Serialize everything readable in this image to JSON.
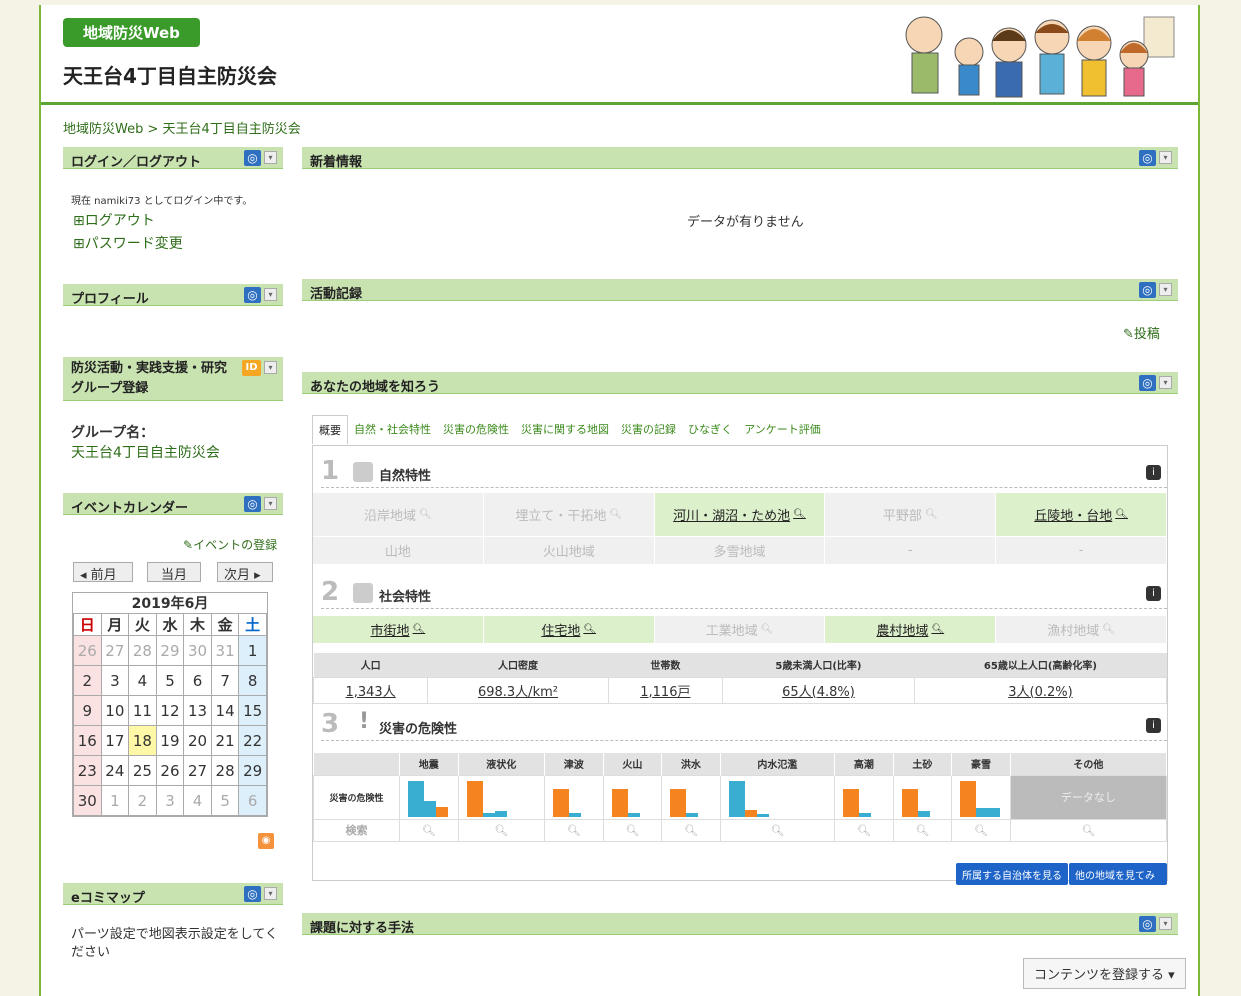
{
  "header": {
    "badge": "地域防災Web",
    "title": "天王台4丁目自主防災会"
  },
  "breadcrumb": {
    "root": "地域防災Web",
    "sep": " > ",
    "current": "天王台4丁目自主防災会"
  },
  "left": {
    "login": {
      "title": "ログイン／ログアウト",
      "status": "現在 namiki73 としてログイン中です。",
      "logout": "ログアウト",
      "password": "パスワード変更"
    },
    "profile": {
      "title": "プロフィール"
    },
    "group": {
      "title_line1": "防災活動・実践支援・研究",
      "title_line2": "グループ登録",
      "id_badge": "ID",
      "name_label": "グループ名：",
      "name_value": "天王台4丁目自主防災会"
    },
    "calendar": {
      "title": "イベントカレンダー",
      "add_event": "イベントの登録",
      "prev": "◂ 前月",
      "today": "当月",
      "next": "次月 ▸",
      "month": "2019年6月",
      "weekdays": [
        "日",
        "月",
        "火",
        "水",
        "木",
        "金",
        "土"
      ],
      "rows": [
        [
          "26",
          "27",
          "28",
          "29",
          "30",
          "31",
          "1"
        ],
        [
          "2",
          "3",
          "4",
          "5",
          "6",
          "7",
          "8"
        ],
        [
          "9",
          "10",
          "11",
          "12",
          "13",
          "14",
          "15"
        ],
        [
          "16",
          "17",
          "18",
          "19",
          "20",
          "21",
          "22"
        ],
        [
          "23",
          "24",
          "25",
          "26",
          "27",
          "28",
          "29"
        ],
        [
          "30",
          "1",
          "2",
          "3",
          "4",
          "5",
          "6"
        ]
      ]
    },
    "ecomap": {
      "title": "eコミマップ",
      "note": "パーツ設定で地図表示設定をしてください"
    }
  },
  "main": {
    "news": {
      "title": "新着情報",
      "empty": "データが有りません"
    },
    "activity": {
      "title": "活動記録",
      "post": "投稿"
    },
    "know": {
      "title": "あなたの地域を知ろう",
      "tabs": [
        "概要",
        "自然・社会特性",
        "災害の危険性",
        "災害に関する地図",
        "災害の記録",
        "ひなぎく",
        "アンケート評価"
      ],
      "s1": {
        "num": "1",
        "label": "自然特性"
      },
      "nature_row1": [
        "沿岸地域",
        "埋立て・干拓地",
        "河川・湖沼・ため池",
        "平野部",
        "丘陵地・台地"
      ],
      "nature_row2": [
        "山地",
        "火山地域",
        "多雪地域",
        "-",
        "-"
      ],
      "s2": {
        "num": "2",
        "label": "社会特性"
      },
      "social": [
        "市街地",
        "住宅地",
        "工業地域",
        "農村地域",
        "漁村地域"
      ],
      "stats_head": [
        "人口",
        "人口密度",
        "世帯数",
        "5歳未満人口(比率)",
        "65歳以上人口(高齢化率)"
      ],
      "stats_vals": [
        "1,343人",
        "698.3人/km²",
        "1,116戸",
        "65人(4.8%)",
        "3人(0.2%)"
      ],
      "s3": {
        "num": "3",
        "label": "災害の危険性"
      },
      "hazards": [
        "地震",
        "液状化",
        "津波",
        "火山",
        "洪水",
        "内水氾濫",
        "高潮",
        "土砂",
        "豪雪",
        "その他"
      ],
      "hazard_row_label": "災害の危険性",
      "search_row_label": "検索",
      "no_data": "データなし",
      "btn_local": "所属する自治体を見る",
      "btn_other": "他の地域を見てみる"
    },
    "methods": {
      "title": "課題に対する手法",
      "register": "コンテンツを登録する ▾"
    }
  }
}
